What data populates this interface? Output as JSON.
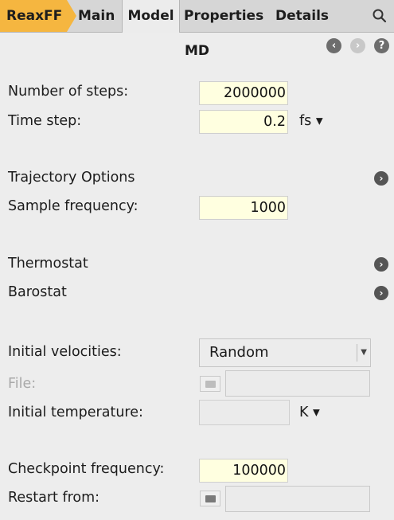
{
  "tabs": {
    "app": "ReaxFF",
    "items": [
      "Main",
      "Model",
      "Properties",
      "Details"
    ],
    "active": "Model"
  },
  "panel": {
    "title": "MD"
  },
  "md": {
    "number_of_steps": {
      "label": "Number of steps:",
      "value": "2000000"
    },
    "time_step": {
      "label": "Time step:",
      "value": "0.2",
      "unit": "fs ▾"
    },
    "trajectory": {
      "label": "Trajectory Options"
    },
    "sample_frequency": {
      "label": "Sample frequency:",
      "value": "1000"
    },
    "thermostat": {
      "label": "Thermostat"
    },
    "barostat": {
      "label": "Barostat"
    },
    "initial_velocities": {
      "label": "Initial velocities:",
      "value": "Random"
    },
    "file": {
      "label": "File:"
    },
    "initial_temperature": {
      "label": "Initial temperature:",
      "value": "",
      "unit": "K ▾"
    },
    "checkpoint_frequency": {
      "label": "Checkpoint frequency:",
      "value": "100000"
    },
    "restart_from": {
      "label": "Restart from:"
    }
  },
  "icons": {
    "search": "search-icon",
    "back": "chevron-left-icon",
    "forward": "chevron-right-icon",
    "help": "help-icon",
    "expand": "chevron-right-icon",
    "folder": "folder-icon"
  },
  "colors": {
    "app_tab": "#f5b640",
    "input_bg": "#ffffe0",
    "panel_bg": "#ededed"
  }
}
